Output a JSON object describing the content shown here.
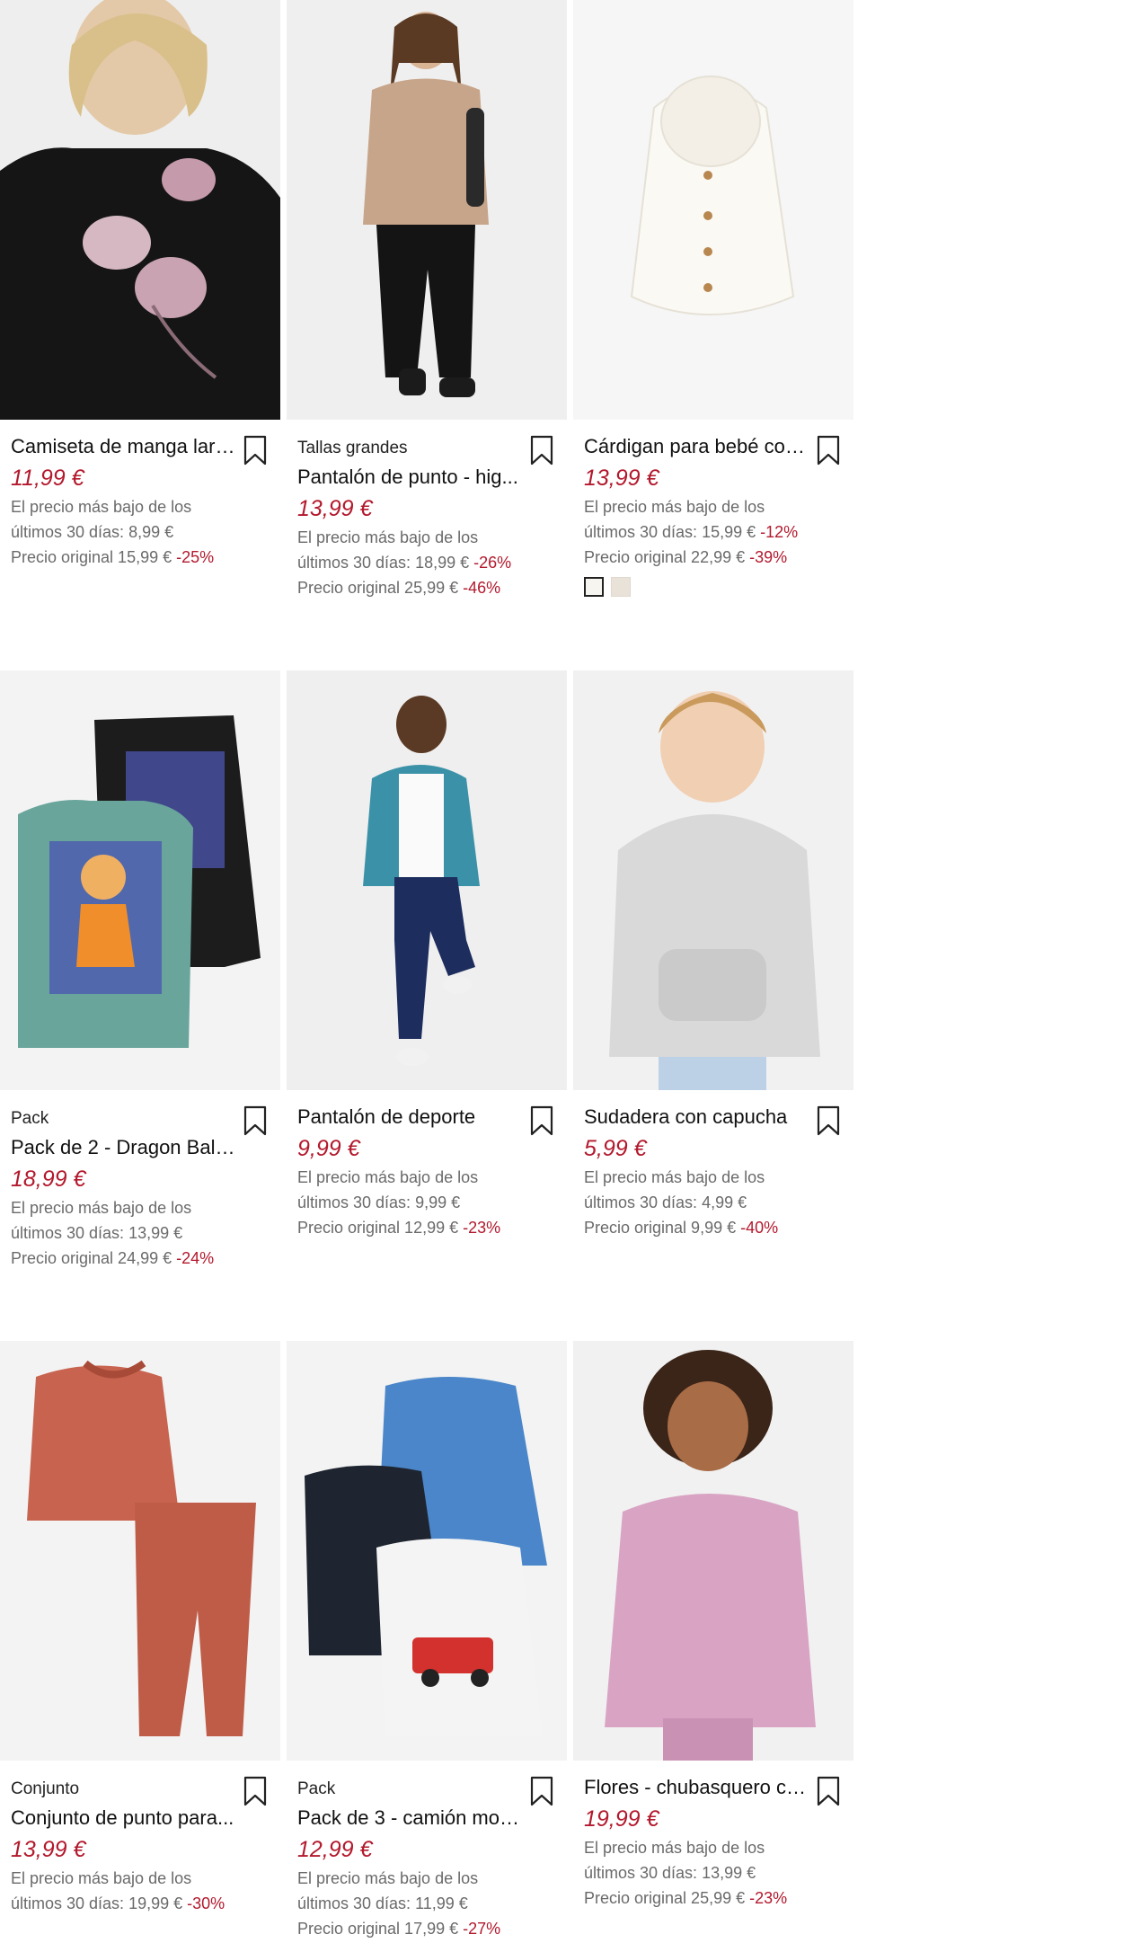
{
  "products": [
    {
      "tag": "",
      "title": "Camiseta de manga larg...",
      "price": "11,99 €",
      "low_line1": "El precio más bajo de los",
      "low_line2_text": "últimos 30 días: 8,99 €",
      "low_line2_disc": "",
      "orig_text": "Precio original 15,99 €",
      "orig_disc": "-25%",
      "swatches": false
    },
    {
      "tag": "Tallas grandes",
      "title": "Pantalón de punto - hig...",
      "price": "13,99 €",
      "low_line1": "El precio más bajo de los",
      "low_line2_text": "últimos 30 días: 18,99 €",
      "low_line2_disc": "-26%",
      "orig_text": "Precio original 25,99 €",
      "orig_disc": "-46%",
      "swatches": false
    },
    {
      "tag": "",
      "title": "Cárdigan para bebé con...",
      "price": "13,99 €",
      "low_line1": "El precio más bajo de los",
      "low_line2_text": "últimos 30 días: 15,99 €",
      "low_line2_disc": "-12%",
      "orig_text": "Precio original 22,99 €",
      "orig_disc": "-39%",
      "swatches": true
    },
    {
      "tag": "Pack",
      "title": "Pack de 2 - Dragon Ball ...",
      "price": "18,99 €",
      "low_line1": "El precio más bajo de los",
      "low_line2_text": "últimos 30 días: 13,99 €",
      "low_line2_disc": "",
      "orig_text": "Precio original 24,99 €",
      "orig_disc": "-24%",
      "swatches": false
    },
    {
      "tag": "",
      "title": "Pantalón de deporte",
      "price": "9,99 €",
      "low_line1": "El precio más bajo de los",
      "low_line2_text": "últimos 30 días: 9,99 €",
      "low_line2_disc": "",
      "orig_text": "Precio original 12,99 €",
      "orig_disc": "-23%",
      "swatches": false
    },
    {
      "tag": "",
      "title": "Sudadera con capucha",
      "price": "5,99 €",
      "low_line1": "El precio más bajo de los",
      "low_line2_text": "últimos 30 días: 4,99 €",
      "low_line2_disc": "",
      "orig_text": "Precio original 9,99 €",
      "orig_disc": "-40%",
      "swatches": false
    },
    {
      "tag": "Conjunto",
      "title": "Conjunto de punto para...",
      "price": "13,99 €",
      "low_line1": "El precio más bajo de los",
      "low_line2_text": "últimos 30 días: 19,99 €",
      "low_line2_disc": "-30%",
      "orig_text": "",
      "orig_disc": "",
      "swatches": false
    },
    {
      "tag": "Pack",
      "title": "Pack de 3 - camión mon...",
      "price": "12,99 €",
      "low_line1": "El precio más bajo de los",
      "low_line2_text": "últimos 30 días: 11,99 €",
      "low_line2_disc": "",
      "orig_text": "Precio original 17,99 €",
      "orig_disc": "-27%",
      "swatches": false
    },
    {
      "tag": "",
      "title": "Flores - chubasquero co...",
      "price": "19,99 €",
      "low_line1": "El precio más bajo de los",
      "low_line2_text": "últimos 30 días: 13,99 €",
      "low_line2_disc": "",
      "orig_text": "Precio original 25,99 €",
      "orig_disc": "-23%",
      "swatches": false
    }
  ],
  "icons": {
    "bookmark": "bookmark-icon"
  },
  "colors": {
    "price": "#b3192d",
    "muted": "#6a6a6a",
    "image_bg": "#f1f1f1"
  }
}
